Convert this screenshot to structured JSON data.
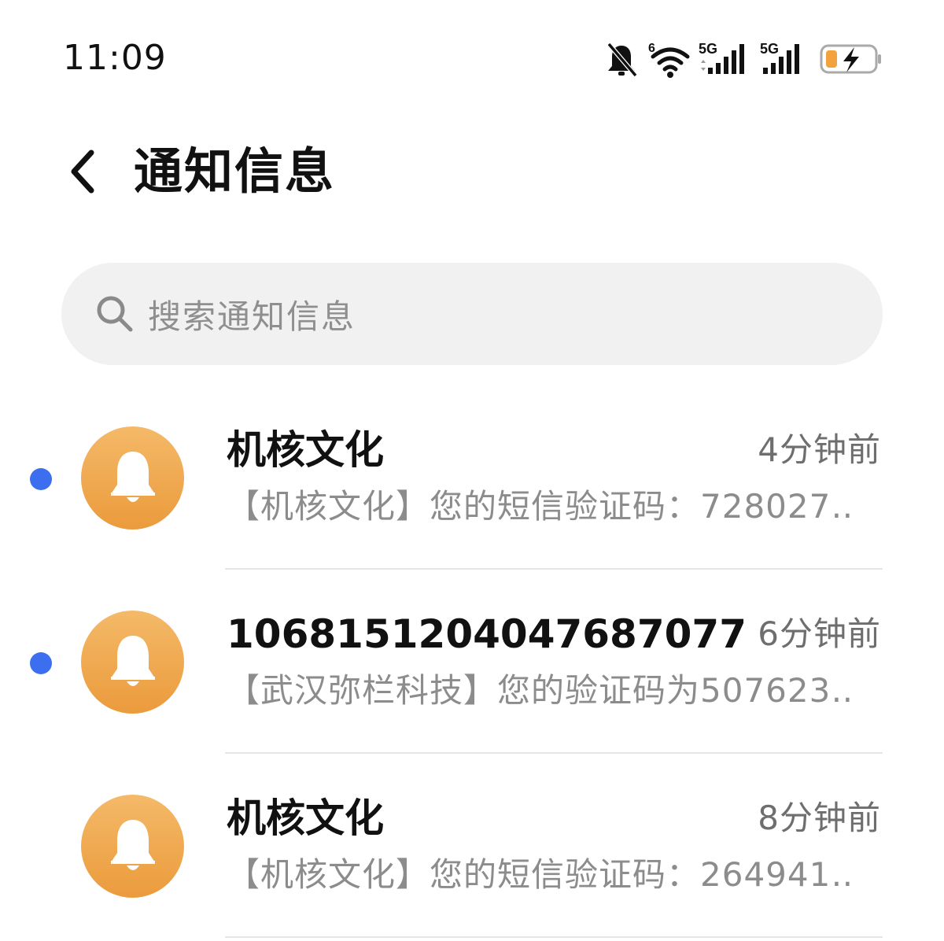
{
  "status_bar": {
    "time": "11:09",
    "icons": [
      "mute-icon",
      "wifi-icon",
      "signal-5g-1-icon",
      "signal-5g-2-icon",
      "battery-charging-icon"
    ],
    "wifi_badge": "6",
    "network_1": "5G",
    "network_2": "5G"
  },
  "header": {
    "back_icon": "chevron-left-icon",
    "title": "通知信息"
  },
  "search": {
    "icon": "search-icon",
    "placeholder": "搜索通知信息"
  },
  "messages": [
    {
      "sender": "机核文化",
      "time": "4分钟前",
      "preview": "【机核文化】您的短信验证码：728027…",
      "unread": true,
      "avatar_icon": "bell-icon"
    },
    {
      "sender": "1068151204047687077",
      "time": "6分钟前",
      "preview": "【武汉弥栏科技】您的验证码为507623…",
      "unread": true,
      "avatar_icon": "bell-icon"
    },
    {
      "sender": "机核文化",
      "time": "8分钟前",
      "preview": "【机核文化】您的短信验证码：264941…",
      "unread": false,
      "avatar_icon": "bell-icon"
    }
  ],
  "colors": {
    "unread_dot": "#3c6ff0",
    "avatar_top": "#f4b968",
    "avatar_bottom": "#eb9b3c",
    "search_bg": "#f1f1f1",
    "battery_charge": "#f3a33d"
  }
}
